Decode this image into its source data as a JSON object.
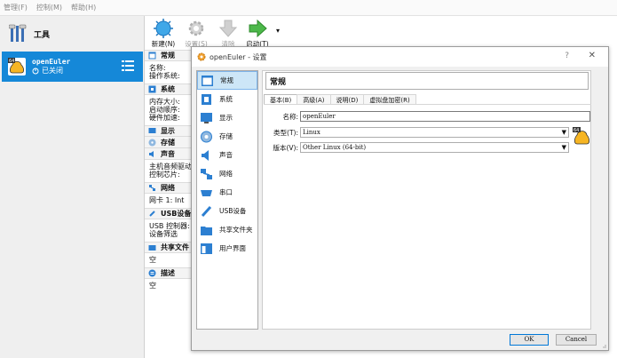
{
  "menubar": {
    "items": [
      "管理(F)",
      "控制(M)",
      "帮助(H)"
    ]
  },
  "sidebar": {
    "tools_label": "工具",
    "vm": {
      "name": "openEuler",
      "state": "已关闭"
    }
  },
  "toolbar": {
    "new": "新建(N)",
    "settings": "设置(S)",
    "discard": "清除",
    "start": "启动(T)",
    "menu_arrow": "▾"
  },
  "details": {
    "general": {
      "title": "常规",
      "lines": [
        "名称:",
        "操作系统:"
      ]
    },
    "system": {
      "title": "系统",
      "lines": [
        "内存大小:",
        "启动顺序:",
        "硬件加速:"
      ]
    },
    "display": {
      "title": "显示"
    },
    "storage": {
      "title": "存储"
    },
    "audio": {
      "title": "声音",
      "lines": [
        "主机音频驱动",
        "控制芯片:"
      ]
    },
    "network": {
      "title": "网络",
      "lines": [
        "网卡 1: Int"
      ]
    },
    "usb": {
      "title": "USB设备",
      "lines": [
        "USB 控制器:",
        "设备筛选"
      ]
    },
    "shared": {
      "title": "共享文件",
      "lines": [
        "空"
      ]
    },
    "description": {
      "title": "描述",
      "lines": [
        "空"
      ]
    }
  },
  "dialog": {
    "title": "openEuler - 设置",
    "help": "?",
    "close": "✕",
    "nav": [
      "常规",
      "系统",
      "显示",
      "存储",
      "声音",
      "网络",
      "串口",
      "USB设备",
      "共享文件夹",
      "用户界面"
    ],
    "page_title": "常规",
    "tabs": [
      "基本(B)",
      "高级(A)",
      "说明(D)",
      "虚拟盘加密(R)"
    ],
    "name_label": "名称:",
    "name_value": "openEuler",
    "type_label": "类型(T):",
    "type_value": "Linux",
    "version_label": "版本(V):",
    "version_value": "Other Linux (64-bit)",
    "os_badge": "64",
    "ok": "OK",
    "cancel": "Cancel"
  },
  "colors": {
    "selection": "#1588d8",
    "nav_selected": "#cde6f7"
  }
}
